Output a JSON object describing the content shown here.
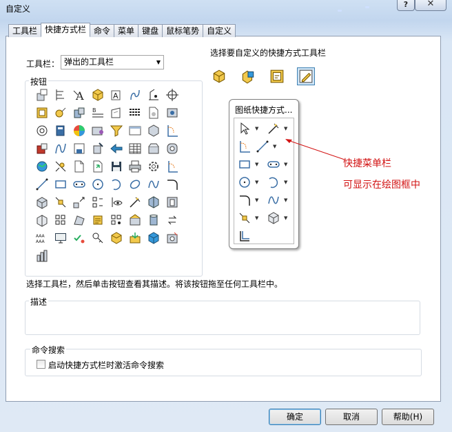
{
  "window": {
    "title": "自定义",
    "help_label": "?",
    "close_label": "✕"
  },
  "tabs": [
    "工具栏",
    "快捷方式栏",
    "命令",
    "菜单",
    "键盘",
    "鼠标笔势",
    "自定义"
  ],
  "active_tab": "快捷方式栏",
  "toolbar_label": "工具栏：",
  "toolbar_select": {
    "value": "弹出的工具栏"
  },
  "buttons_group": {
    "title": "按钮"
  },
  "select_prompt": "选择要自定义的快捷方式工具栏",
  "shortcut_toolbars": [
    "part-toolbar-icon",
    "assembly-toolbar-icon",
    "drawing-toolbar-icon",
    "sketch-toolbar-icon"
  ],
  "popup": {
    "title": "图纸快捷方式..."
  },
  "annotation": {
    "line1": "快捷菜单栏",
    "line2": "可显示在绘图框中",
    "color": "#d21212"
  },
  "instruction": "选择工具栏，然后单击按钮查看其描述。将该按钮拖至任何工具栏中。",
  "description_group": {
    "title": "描述"
  },
  "command_search": {
    "title": "命令搜索",
    "checkbox_label": "启动快捷方式栏时激活命令搜索"
  },
  "dialog_buttons": {
    "ok": "确定",
    "cancel": "取消",
    "help": "帮助(H)"
  }
}
